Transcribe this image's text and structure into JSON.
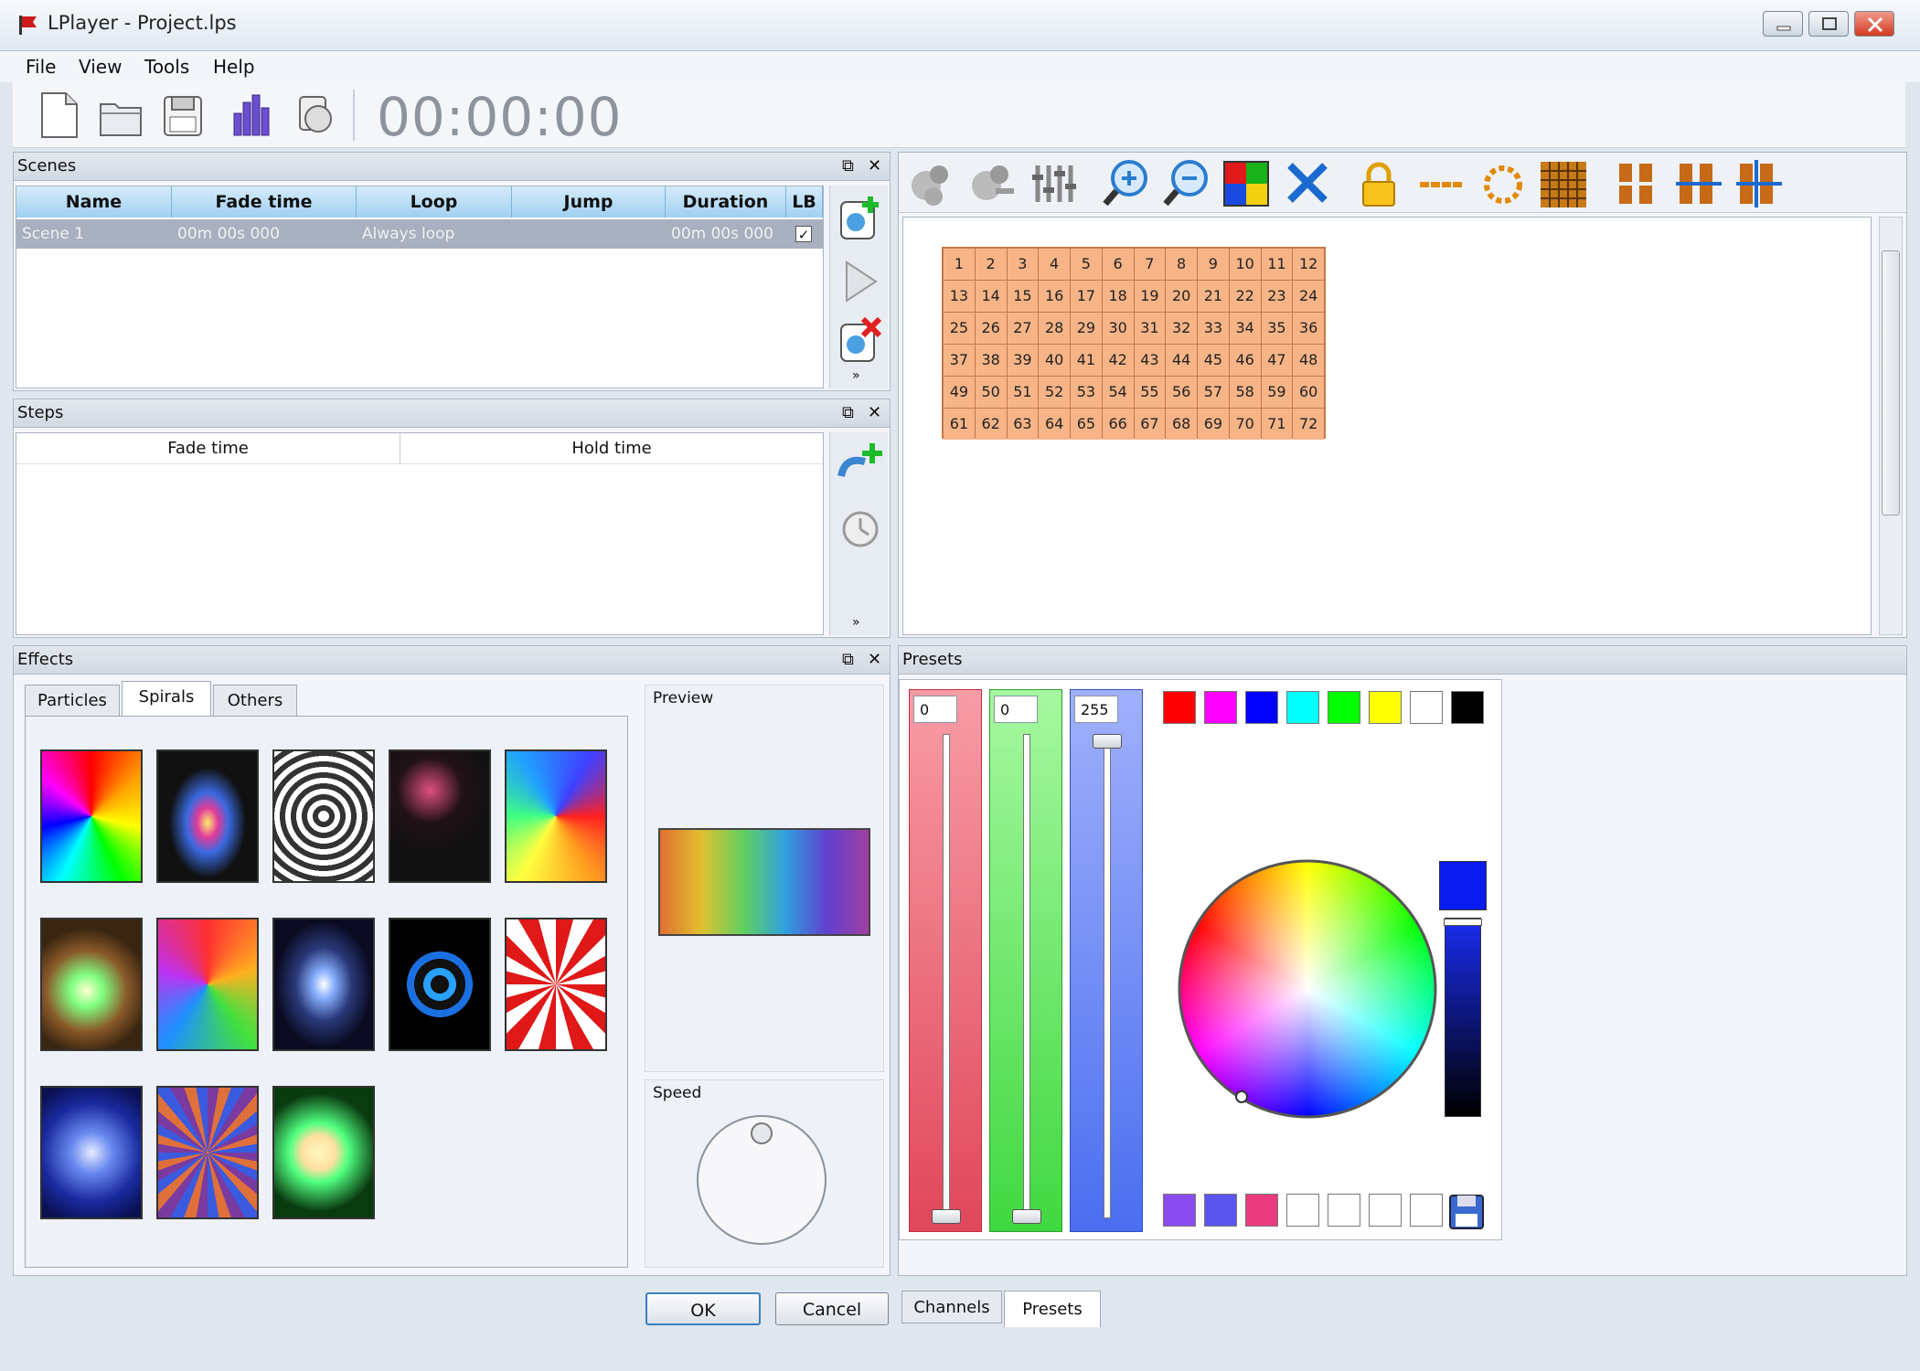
{
  "window": {
    "title": "LPlayer  - Project.lps"
  },
  "menu": {
    "file": "File",
    "view": "View",
    "tools": "Tools",
    "help": "Help"
  },
  "toolbar": {
    "timer": "00:00:00"
  },
  "scenes": {
    "title": "Scenes",
    "columns": [
      "Name",
      "Fade time",
      "Loop",
      "Jump",
      "Duration",
      "LB"
    ],
    "row": {
      "name": "Scene 1",
      "fade": "00m 00s 000",
      "loop": "Always loop",
      "jump": "",
      "duration": "00m 00s 000"
    }
  },
  "steps": {
    "title": "Steps",
    "columns": [
      "Fade time",
      "Hold time"
    ]
  },
  "grid": {
    "cells": [
      "1",
      "2",
      "3",
      "4",
      "5",
      "6",
      "7",
      "8",
      "9",
      "10",
      "11",
      "12",
      "13",
      "14",
      "15",
      "16",
      "17",
      "18",
      "19",
      "20",
      "21",
      "22",
      "23",
      "24",
      "25",
      "26",
      "27",
      "28",
      "29",
      "30",
      "31",
      "32",
      "33",
      "34",
      "35",
      "36",
      "37",
      "38",
      "39",
      "40",
      "41",
      "42",
      "43",
      "44",
      "45",
      "46",
      "47",
      "48",
      "49",
      "50",
      "51",
      "52",
      "53",
      "54",
      "55",
      "56",
      "57",
      "58",
      "59",
      "60",
      "61",
      "62",
      "63",
      "64",
      "65",
      "66",
      "67",
      "68",
      "69",
      "70",
      "71",
      "72"
    ]
  },
  "effects": {
    "title": "Effects",
    "tabs": [
      "Particles",
      "Spirals",
      "Others"
    ],
    "preview_label": "Preview",
    "speed_label": "Speed"
  },
  "presets": {
    "title": "Presets",
    "red_value": "0",
    "green_value": "0",
    "blue_value": "255",
    "swatches_top": [
      "#ff0000",
      "#ff00ff",
      "#0000ff",
      "#00ffff",
      "#00ff00",
      "#ffff00",
      "#ffffff",
      "#000000"
    ],
    "swatches_bottom": [
      "#8a4cf0",
      "#5a55ef",
      "#e93a7d",
      "#ffffff",
      "#ffffff",
      "#ffffff",
      "#ffffff"
    ],
    "selected_color": "#0a1cf0"
  },
  "buttons": {
    "ok": "OK",
    "cancel": "Cancel"
  },
  "bottom_tabs": [
    "Channels",
    "Presets"
  ]
}
